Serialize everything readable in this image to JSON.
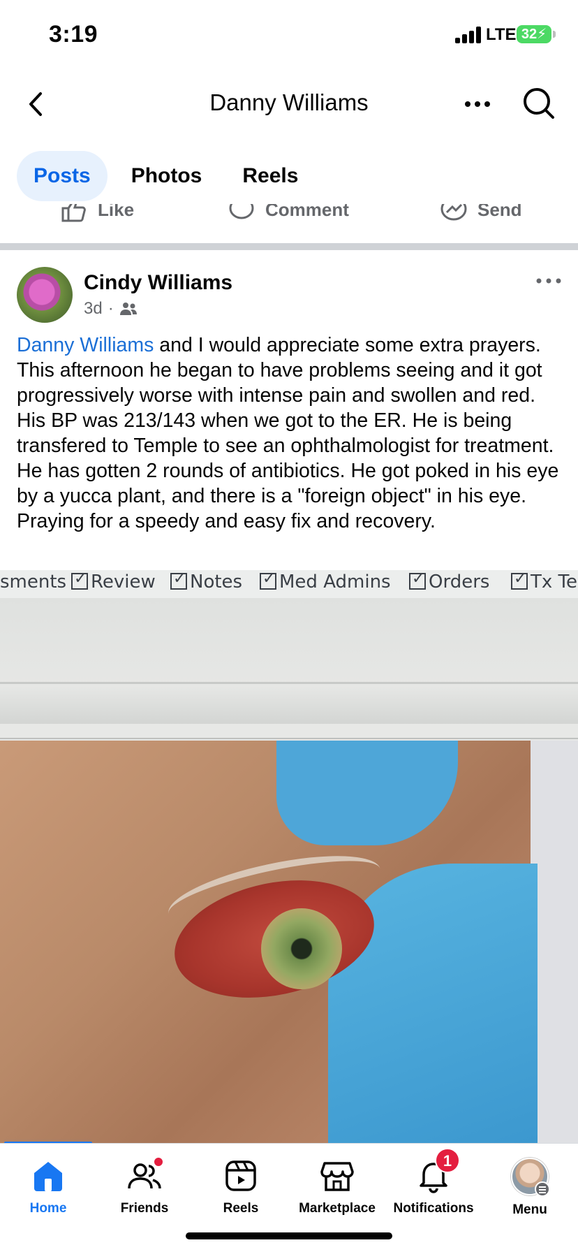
{
  "status_bar": {
    "time": "3:19",
    "network": "LTE",
    "battery": "32"
  },
  "header": {
    "title": "Danny Williams",
    "back_icon": "chevron-left-icon",
    "more_icon": "more-horizontal-icon",
    "search_icon": "search-icon"
  },
  "tabs": [
    {
      "label": "Posts",
      "active": true
    },
    {
      "label": "Photos",
      "active": false
    },
    {
      "label": "Reels",
      "active": false
    }
  ],
  "actions": {
    "like": "Like",
    "comment": "Comment",
    "send": "Send"
  },
  "post": {
    "author": "Cindy Williams",
    "time": "3d",
    "separator": "·",
    "audience_icon": "friends-icon",
    "mention": "Danny Williams",
    "text": " and I would appreciate some extra prayers.  This afternoon he began to have problems seeing and it got progressively worse with intense pain and swollen and red. His BP was 213/143 when we got to the ER. He is being transfered to Temple to see an ophthalmologist for treatment. He has gotten 2 rounds of antibiotics.  He got poked in his eye by a yucca plant, and there is a \"foreign object\" in his eye. Praying for a speedy and easy fix and recovery."
  },
  "photo": {
    "screen_labels": [
      "sments",
      "Review",
      "Notes",
      "Med Admins",
      "Orders",
      "Tx Te"
    ]
  },
  "bottom_nav": [
    {
      "label": "Home",
      "icon": "home-icon",
      "active": true
    },
    {
      "label": "Friends",
      "icon": "friends-icon",
      "active": false,
      "dot": true
    },
    {
      "label": "Reels",
      "icon": "reels-icon",
      "active": false
    },
    {
      "label": "Marketplace",
      "icon": "marketplace-icon",
      "active": false
    },
    {
      "label": "Notifications",
      "icon": "bell-icon",
      "active": false,
      "badge": "1"
    },
    {
      "label": "Menu",
      "icon": "avatar-icon",
      "active": false
    }
  ],
  "colors": {
    "accent": "#1877f2",
    "tab_active_bg": "#e7f1fd",
    "mention": "#1b6fd6",
    "badge": "#e41e3f",
    "secondary_text": "#65676b"
  }
}
